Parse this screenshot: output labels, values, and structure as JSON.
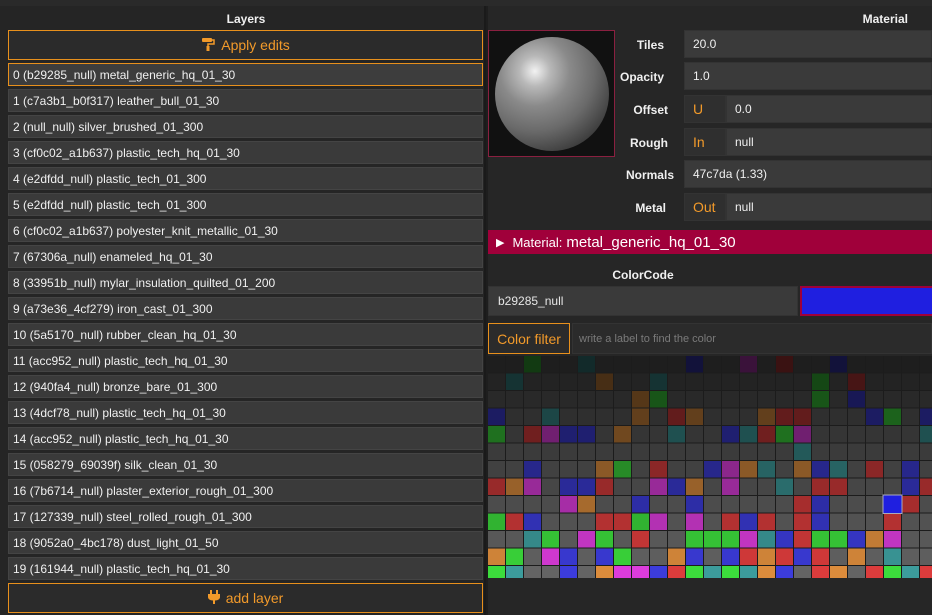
{
  "layers_panel": {
    "title": "Layers",
    "apply_label": "Apply edits",
    "add_label": "add layer",
    "items": [
      "0 (b29285_null) metal_generic_hq_01_30",
      "1 (c7a3b1_b0f317) leather_bull_01_30",
      "2 (null_null) silver_brushed_01_300",
      "3 (cf0c02_a1b637) plastic_tech_hq_01_30",
      "4 (e2dfdd_null) plastic_tech_01_300",
      "5 (e2dfdd_null) plastic_tech_01_300",
      "6 (cf0c02_a1b637) polyester_knit_metallic_01_30",
      "7 (67306a_null) enameled_hq_01_30",
      "8 (33951b_null) mylar_insulation_quilted_01_200",
      "9 (a73e36_4cf279) iron_cast_01_300",
      "10 (5a5170_null) rubber_clean_hq_01_30",
      "11 (acc952_null) plastic_tech_hq_01_30",
      "12 (940fa4_null) bronze_bare_01_300",
      "13 (4dcf78_null) plastic_tech_hq_01_30",
      "14 (acc952_null) plastic_tech_hq_01_30",
      "15 (058279_69039f) silk_clean_01_30",
      "16 (7b6714_null) plaster_exterior_rough_01_300",
      "17 (127339_null) steel_rolled_rough_01_300",
      "18 (9052a0_4bc178) dust_light_01_50",
      "19 (161944_null) plastic_tech_hq_01_30"
    ],
    "selected_index": 0
  },
  "material_panel": {
    "title": "Material",
    "props": {
      "tiles_label": "Tiles",
      "tiles_value": "20.0",
      "opacity_label": "Opacity",
      "opacity_value": "1.0",
      "offset_label": "Offset",
      "offset_tag": "U",
      "offset_value": "0.0",
      "rough_label": "Rough",
      "rough_tag": "In",
      "rough_value": "null",
      "normals_label": "Normals",
      "normals_value": "47c7da (1.33)",
      "metal_label": "Metal",
      "metal_tag": "Out",
      "metal_value": "null"
    },
    "material_bar": {
      "label": "Material:",
      "name": "metal_generic_hq_01_30"
    },
    "colorcode": {
      "title": "ColorCode",
      "value": "b29285_null",
      "swatch_color": "#1f1fe0"
    },
    "filter": {
      "button_label": "Color filter",
      "placeholder": "write a label to find the color"
    }
  },
  "colors": {
    "accent": "#e8901c",
    "material_bar": "#a0003a",
    "panel_bg": "#252525",
    "field_bg": "#3a3a3a"
  }
}
